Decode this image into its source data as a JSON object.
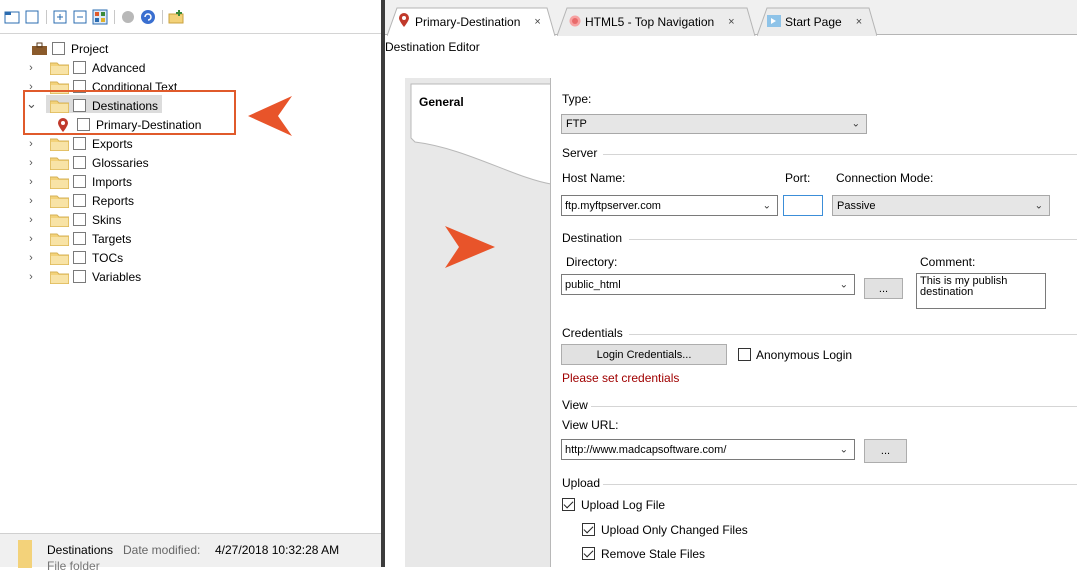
{
  "left_tree": {
    "root": "Project",
    "items": [
      {
        "label": "Advanced",
        "expanded": false
      },
      {
        "label": "Conditional Text",
        "expanded": false
      },
      {
        "label": "Destinations",
        "expanded": true
      },
      {
        "label": "Primary-Destination",
        "child": true
      },
      {
        "label": "Exports",
        "expanded": false
      },
      {
        "label": "Glossaries",
        "expanded": false
      },
      {
        "label": "Imports",
        "expanded": false
      },
      {
        "label": "Reports",
        "expanded": false
      },
      {
        "label": "Skins",
        "expanded": false
      },
      {
        "label": "Targets",
        "expanded": false
      },
      {
        "label": "TOCs",
        "expanded": false
      },
      {
        "label": "Variables",
        "expanded": false
      }
    ]
  },
  "status": {
    "name": "Destinations",
    "date_label": "Date modified:",
    "date_value": "4/27/2018 10:32:28 AM",
    "type": "File folder"
  },
  "tabs": [
    {
      "label": "Primary-Destination",
      "close": "×",
      "active": true
    },
    {
      "label": "HTML5 - Top Navigation",
      "close": "×",
      "active": false
    },
    {
      "label": "Start Page",
      "close": "×",
      "active": false
    }
  ],
  "editor": {
    "title": "Destination Editor",
    "side_tab": "General",
    "type_label": "Type:",
    "type_value": "FTP",
    "server": {
      "section": "Server",
      "host_label": "Host Name:",
      "host_value": "ftp.myftpserver.com",
      "port_label": "Port:",
      "port_value": "",
      "mode_label": "Connection Mode:",
      "mode_value": "Passive"
    },
    "destination": {
      "section": "Destination",
      "dir_label": "Directory:",
      "dir_value": "public_html",
      "browse": "...",
      "comment_label": "Comment:",
      "comment_value": "This is my publish destination"
    },
    "credentials": {
      "section": "Credentials",
      "button": "Login Credentials...",
      "anon_label": "Anonymous Login",
      "anon_checked": false,
      "warning": "Please set credentials"
    },
    "view": {
      "section": "View",
      "url_label": "View URL:",
      "url_value": "http://www.madcapsoftware.com/",
      "browse": "..."
    },
    "upload": {
      "section": "Upload",
      "log_label": "Upload Log File",
      "log_checked": true,
      "changed_label": "Upload Only Changed Files",
      "changed_checked": true,
      "stale_label": "Remove Stale Files",
      "stale_checked": true
    }
  },
  "colors": {
    "accent": "#e05a2b",
    "warning": "#a00000",
    "pin": "#c0392b",
    "folder": "#f3d27a"
  }
}
